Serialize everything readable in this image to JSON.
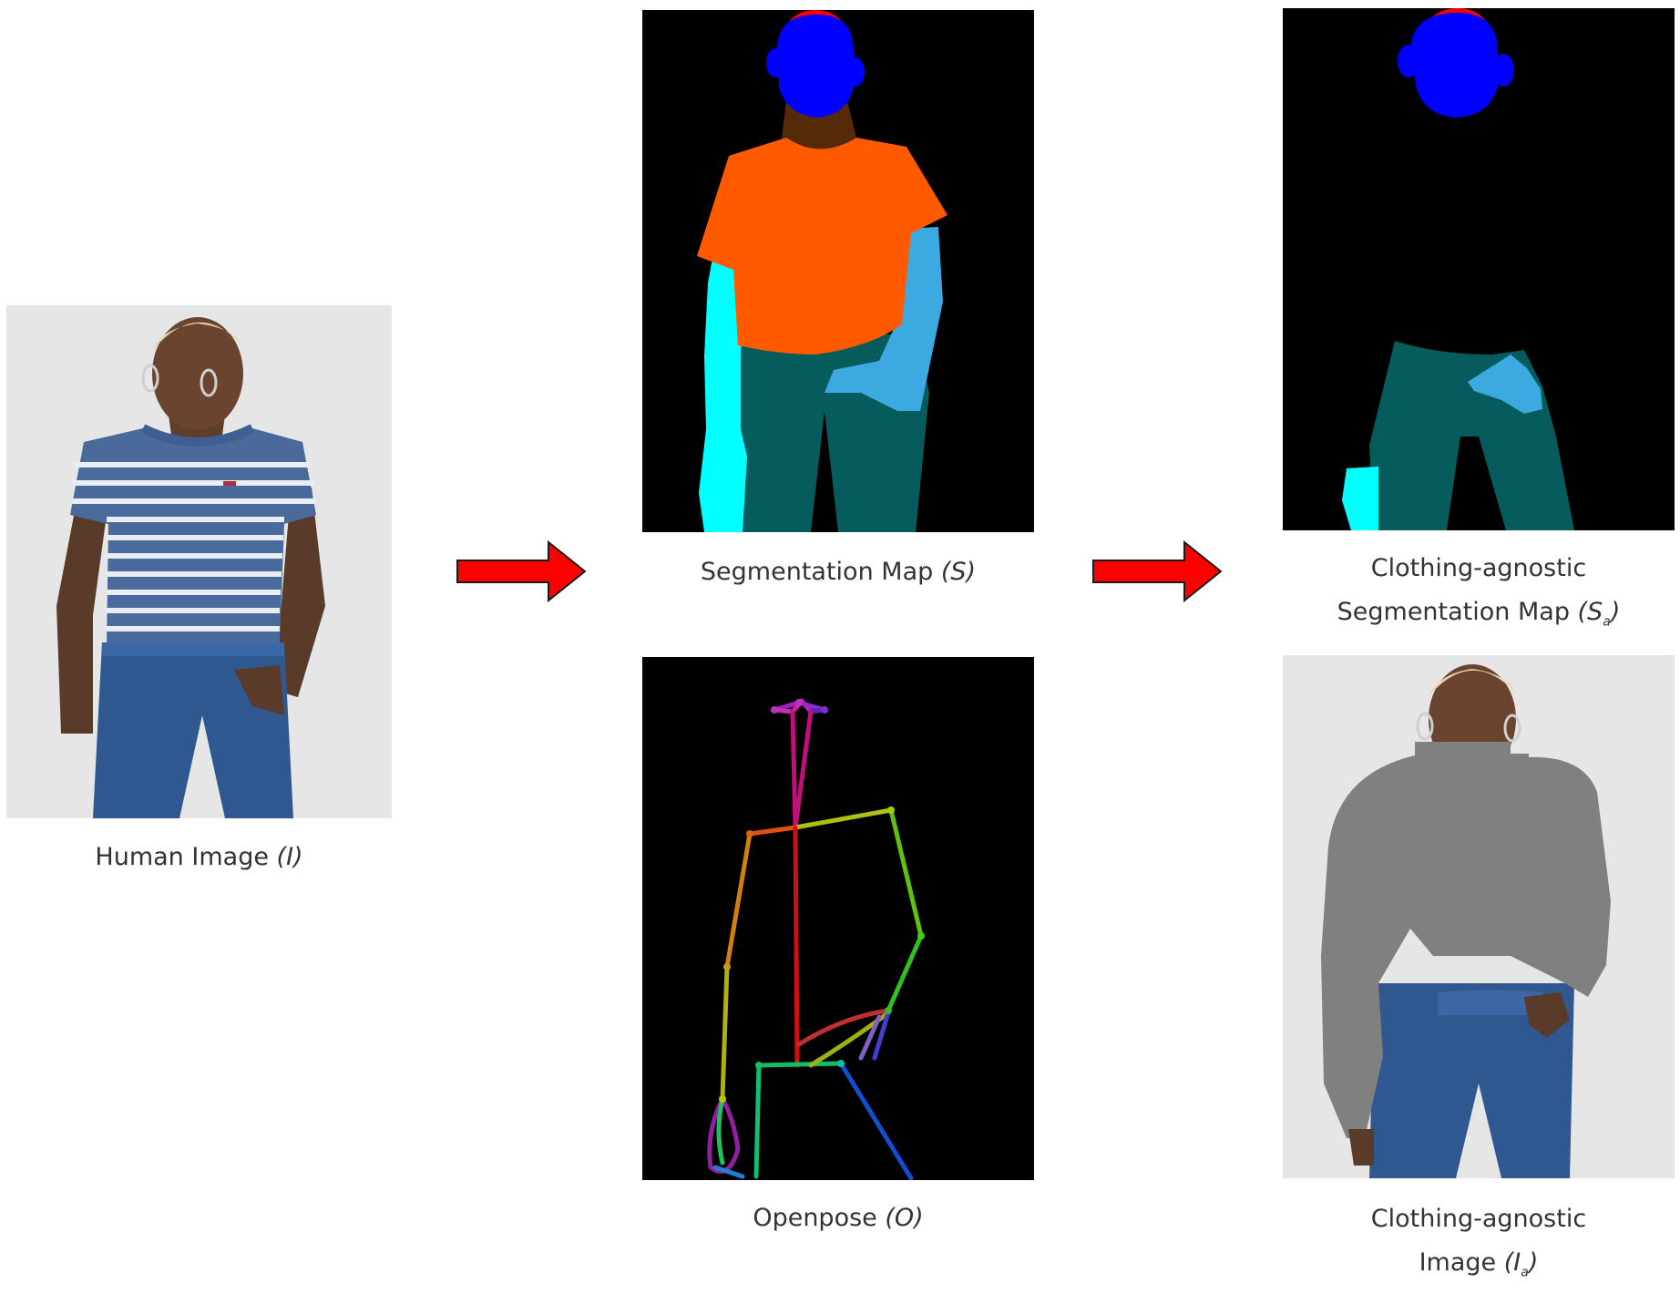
{
  "captions": {
    "human_image": {
      "text": "Human Image ",
      "sym": "(I)"
    },
    "segmentation_map": {
      "text": "Segmentation Map ",
      "sym": "(S)"
    },
    "openpose": {
      "text": "Openpose ",
      "sym": "(O)"
    },
    "agnostic_seg_line1": {
      "text": "Clothing-agnostic"
    },
    "agnostic_seg_line2": {
      "text": "Segmentation Map ",
      "sym_open": "(S",
      "sub": "a",
      "sym_close": ")"
    },
    "agnostic_img_line1": {
      "text": "Clothing-agnostic"
    },
    "agnostic_img_line2": {
      "text": "Image ",
      "sym_open": "(I",
      "sub": "a",
      "sym_close": ")"
    }
  },
  "colors": {
    "arrow_fill": "#ff0000",
    "seg_background": "#000000",
    "hair": "#ff0000",
    "face": "#0000ff",
    "neck": "#542a08",
    "upper_clothes": "#ff5a00",
    "left_arm": "#00ffff",
    "right_arm": "#3caae0",
    "pants": "#065c5c",
    "agnostic_gray": "#808080",
    "photo_background": "#e4e4e4"
  }
}
